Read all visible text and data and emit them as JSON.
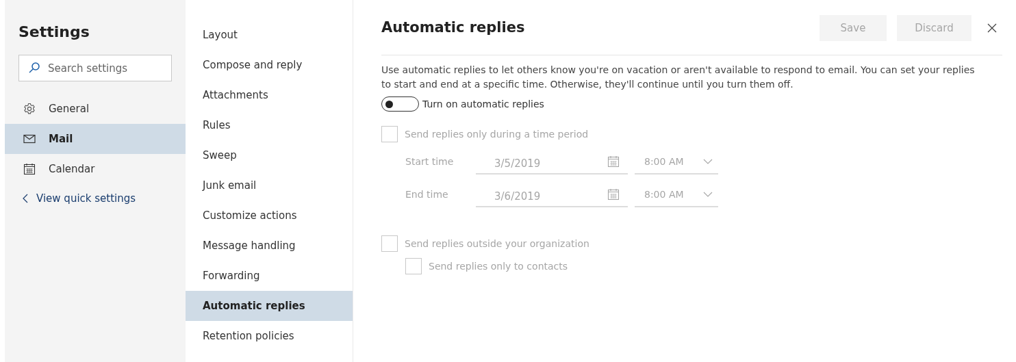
{
  "sidebar": {
    "title": "Settings",
    "search": {
      "placeholder": "Search settings"
    },
    "items": [
      {
        "label": "General",
        "selected": false
      },
      {
        "label": "Mail",
        "selected": true
      },
      {
        "label": "Calendar",
        "selected": false
      }
    ],
    "back_link": "View quick settings"
  },
  "submenu": {
    "items": [
      {
        "label": "Layout",
        "selected": false
      },
      {
        "label": "Compose and reply",
        "selected": false
      },
      {
        "label": "Attachments",
        "selected": false
      },
      {
        "label": "Rules",
        "selected": false
      },
      {
        "label": "Sweep",
        "selected": false
      },
      {
        "label": "Junk email",
        "selected": false
      },
      {
        "label": "Customize actions",
        "selected": false
      },
      {
        "label": "Message handling",
        "selected": false
      },
      {
        "label": "Forwarding",
        "selected": false
      },
      {
        "label": "Automatic replies",
        "selected": true
      },
      {
        "label": "Retention policies",
        "selected": false
      }
    ]
  },
  "panel": {
    "title": "Automatic replies",
    "buttons": [
      {
        "label": "Save",
        "disabled": true
      },
      {
        "label": "Discard",
        "disabled": true
      }
    ],
    "description": "Use automatic replies to let others know you're on vacation or aren't available to respond to email. You can set your replies to start and end at a specific time. Otherwise, they'll continue until you turn them off.",
    "toggle": {
      "label": "Turn on automatic replies",
      "on": false
    },
    "time_period": {
      "label": "Send replies only during a time period",
      "checked": false,
      "disabled": true
    },
    "times": [
      {
        "label": "Start time",
        "date": "3/5/2019",
        "time": "8:00 AM"
      },
      {
        "label": "End time",
        "date": "3/6/2019",
        "time": "8:00 AM"
      }
    ],
    "outside": {
      "label": "Send replies outside your organization",
      "checked": false,
      "disabled": true
    },
    "contacts": {
      "label": "Send replies only to contacts",
      "checked": false,
      "disabled": true
    }
  }
}
